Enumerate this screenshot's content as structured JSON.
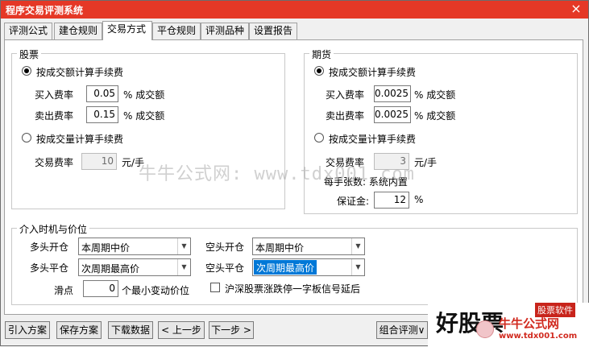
{
  "window": {
    "title": "程序交易评测系统",
    "close_glyph": "×"
  },
  "tabs": [
    {
      "label": "评测公式"
    },
    {
      "label": "建仓规则"
    },
    {
      "label": "交易方式"
    },
    {
      "label": "平仓规则"
    },
    {
      "label": "评测品种"
    },
    {
      "label": "设置报告"
    }
  ],
  "stock": {
    "legend": "股票",
    "by_amount_label": "按成交额计算手续费",
    "buy_label": "买入费率",
    "buy_value": "0.05",
    "buy_unit": "% 成交额",
    "sell_label": "卖出费率",
    "sell_value": "0.15",
    "sell_unit": "% 成交额",
    "by_volume_label": "按成交量计算手续费",
    "fee_label": "交易费率",
    "fee_value": "10",
    "fee_unit": "元/手"
  },
  "futures": {
    "legend": "期货",
    "by_amount_label": "按成交额计算手续费",
    "buy_label": "买入费率",
    "buy_value": "0.0025",
    "buy_unit": "% 成交额",
    "sell_label": "卖出费率",
    "sell_value": "0.0025",
    "sell_unit": "% 成交额",
    "by_volume_label": "按成交量计算手续费",
    "fee_label": "交易费率",
    "fee_value": "3",
    "fee_unit": "元/手",
    "lot_label": "每手张数: 系统内置",
    "margin_label": "保证金:",
    "margin_value": "12",
    "margin_unit": "%"
  },
  "timing": {
    "legend": "介入时机与价位",
    "long_open_label": "多头开仓",
    "long_open_value": "本周期中价",
    "long_close_label": "多头平仓",
    "long_close_value": "次周期最高价",
    "short_open_label": "空头开仓",
    "short_open_value": "本周期中价",
    "short_close_label": "空头平仓",
    "short_close_value": "次周期最高价",
    "slippage_label": "滑点",
    "slippage_value": "0",
    "slippage_unit": "个最小变动价位",
    "delay_label": "沪深股票涨跌停一字板信号延后"
  },
  "buttons": {
    "import": "引入方案",
    "save": "保存方案",
    "download": "下载数据",
    "prev": "< 上一步",
    "next": "下一步 >",
    "combo": "组合评测∨"
  },
  "watermark": "牛牛公式网: www.tdx001.com",
  "logo": {
    "big": "好股票",
    "tag": "股票软件",
    "cn": "牛牛公式网",
    "url": "www.tdx001.com"
  }
}
